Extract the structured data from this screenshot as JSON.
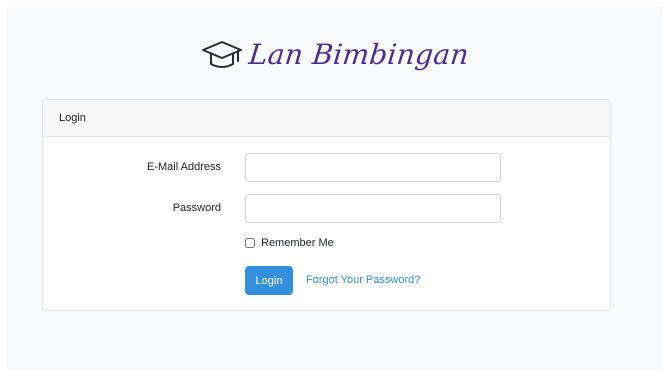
{
  "brand": {
    "name": "Lan Bimbingan",
    "icon": "graduation-cap-icon",
    "color": "#4b2c91"
  },
  "card": {
    "header": "Login"
  },
  "form": {
    "email_label": "E-Mail Address",
    "email_value": "",
    "password_label": "Password",
    "password_value": "",
    "remember_label": "Remember Me",
    "remember_checked": false,
    "submit_label": "Login",
    "forgot_label": "Forgot Your Password?"
  },
  "colors": {
    "primary": "#3490dc",
    "background": "#f8fafc"
  }
}
